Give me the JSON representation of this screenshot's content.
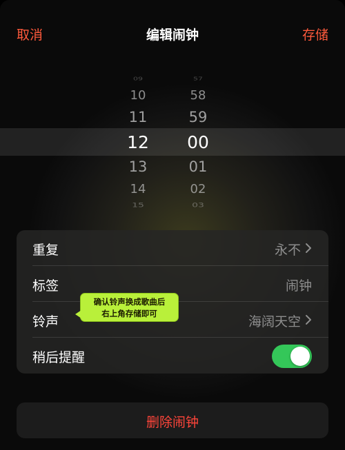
{
  "header": {
    "cancel_label": "取消",
    "title": "编辑闹钟",
    "save_label": "存储"
  },
  "picker": {
    "hours": [
      "09",
      "10",
      "11",
      "12",
      "13",
      "14",
      "15"
    ],
    "minutes": [
      "57",
      "58",
      "59",
      "00",
      "01",
      "02",
      "03"
    ],
    "selected_hour": "12",
    "selected_minute": "00"
  },
  "settings": {
    "repeat": {
      "label": "重复",
      "value": "永不"
    },
    "tag": {
      "label": "标签",
      "value": "闹钟"
    },
    "ringtone": {
      "label": "铃声",
      "value": "海阔天空"
    },
    "snooze": {
      "label": "稍后提醒",
      "enabled": true
    }
  },
  "annotation": {
    "line1": "确认铃声换成歌曲后",
    "line2": "右上角存储即可"
  },
  "delete_label": "删除闹钟",
  "colors": {
    "accent": "#ff5a3c",
    "destructive": "#ff453a",
    "toggle_on": "#34c759",
    "annotation_bg": "#b9f03a"
  }
}
